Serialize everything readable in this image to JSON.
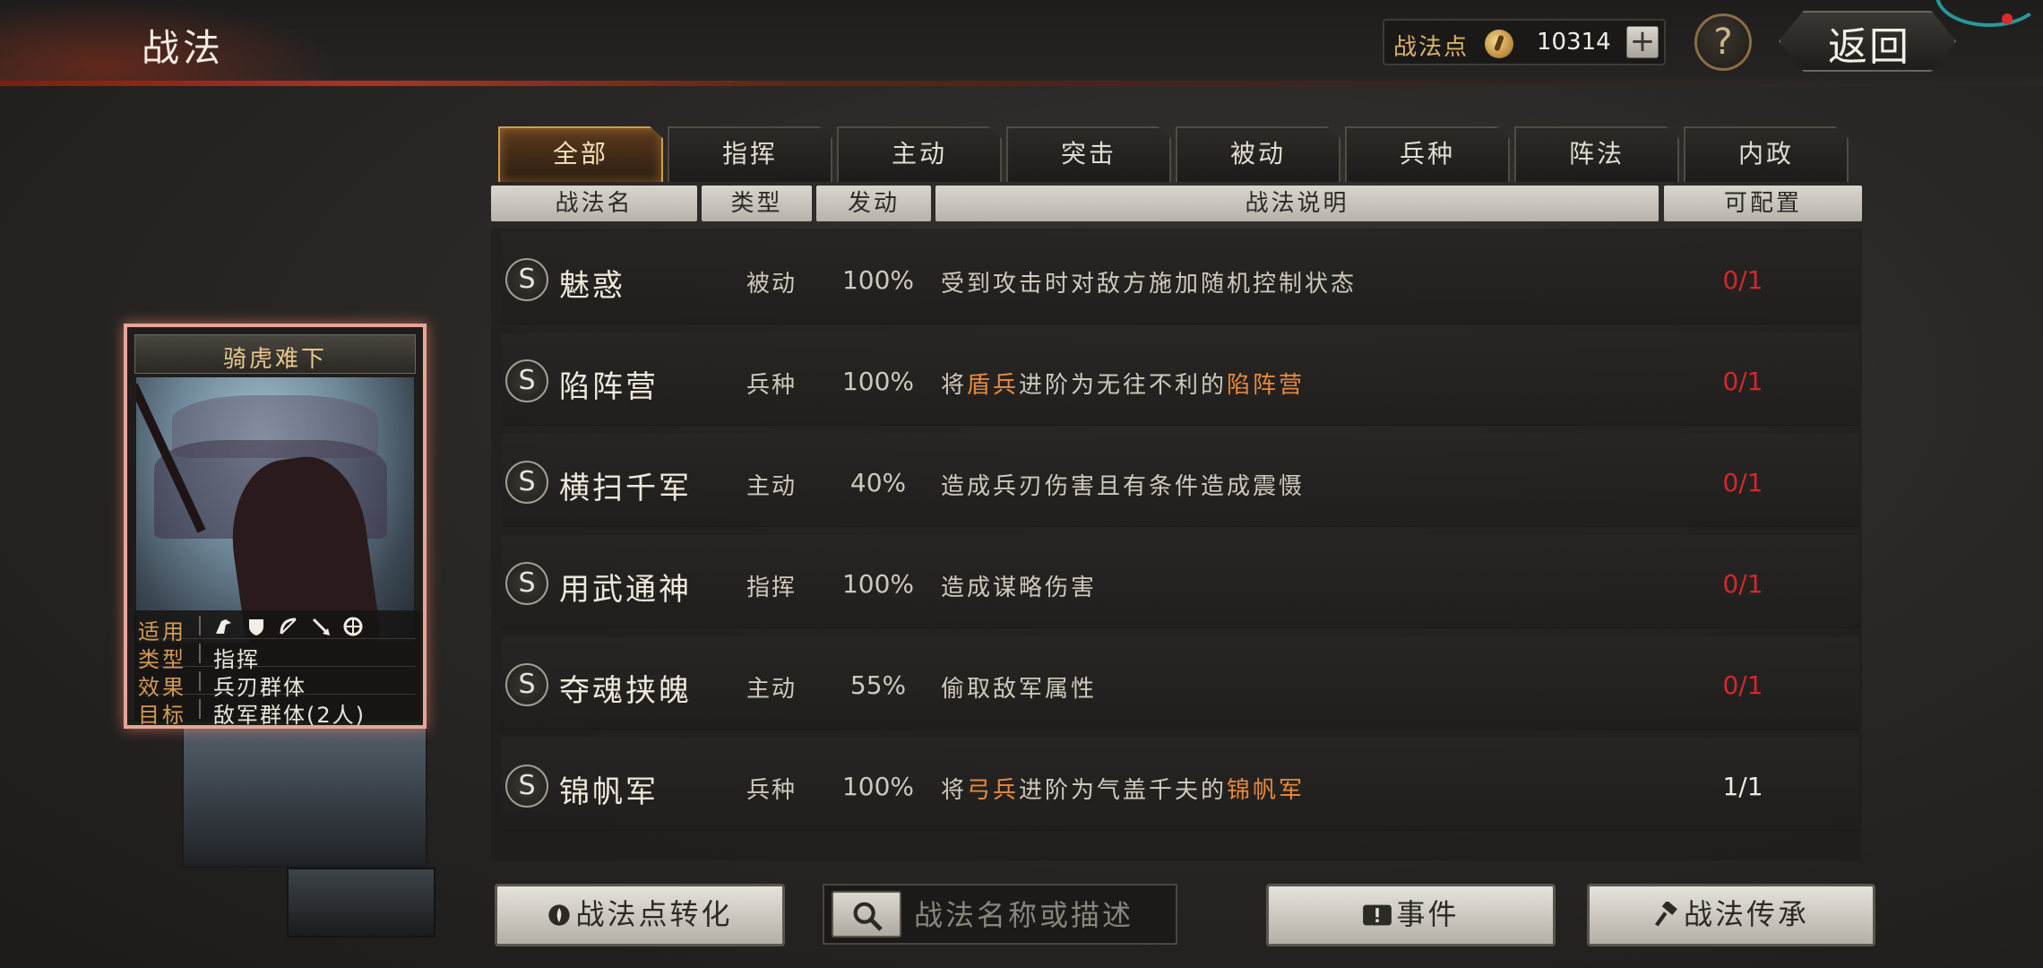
{
  "header": {
    "title": "战法",
    "points_label": "战法点",
    "points_value": "10314",
    "plus": "+",
    "help": "?",
    "back": "返回"
  },
  "tabs": [
    "全部",
    "指挥",
    "主动",
    "突击",
    "被动",
    "兵种",
    "阵法",
    "内政"
  ],
  "active_tab": "全部",
  "columns": {
    "name": "战法名",
    "type": "类型",
    "rate": "发动",
    "desc": "战法说明",
    "config": "可配置"
  },
  "rows": [
    {
      "badge": "S",
      "name": "魅惑",
      "type": "被动",
      "rate": "100%",
      "desc": [
        "受到攻击时对敌方施加随机控制状态"
      ],
      "config": "0/1",
      "config_color": "#d4272a"
    },
    {
      "badge": "S",
      "name": "陷阵营",
      "type": "兵种",
      "rate": "100%",
      "desc": [
        "将",
        "盾兵",
        "进阶为无往不利的",
        "陷阵营"
      ],
      "config": "0/1",
      "config_color": "#d4272a"
    },
    {
      "badge": "S",
      "name": "横扫千军",
      "type": "主动",
      "rate": "40%",
      "desc": [
        "造成兵刃伤害且有条件造成震慑"
      ],
      "config": "0/1",
      "config_color": "#d4272a"
    },
    {
      "badge": "S",
      "name": "用武通神",
      "type": "指挥",
      "rate": "100%",
      "desc": [
        "造成谋略伤害"
      ],
      "config": "0/1",
      "config_color": "#d4272a"
    },
    {
      "badge": "S",
      "name": "夺魂挟魄",
      "type": "主动",
      "rate": "55%",
      "desc": [
        "偷取敌军属性"
      ],
      "config": "0/1",
      "config_color": "#d4272a"
    },
    {
      "badge": "S",
      "name": "锦帆军",
      "type": "兵种",
      "rate": "100%",
      "desc": [
        "将",
        "弓兵",
        "进阶为气盖千夫的",
        "锦帆军"
      ],
      "config": "1/1",
      "config_color": "#f0ece4"
    }
  ],
  "card": {
    "title": "骑虎难下",
    "apply_label": "适用",
    "unit_icons": [
      "cavalry-icon",
      "shield-icon",
      "bow-icon",
      "spear-icon",
      "siege-icon"
    ],
    "type_label": "类型",
    "type_value": "指挥",
    "effect_label": "效果",
    "effect_value": "兵刃群体",
    "target_label": "目标",
    "target_value": "敌军群体(2人)"
  },
  "buttons": {
    "convert": "战法点转化",
    "search_placeholder": "战法名称或描述",
    "event": "事件",
    "inherit": "战法传承"
  },
  "colors": {
    "highlight": "#e88a3c",
    "tab_active_border": "#d49a4c",
    "card_glow": "#e8a597"
  }
}
